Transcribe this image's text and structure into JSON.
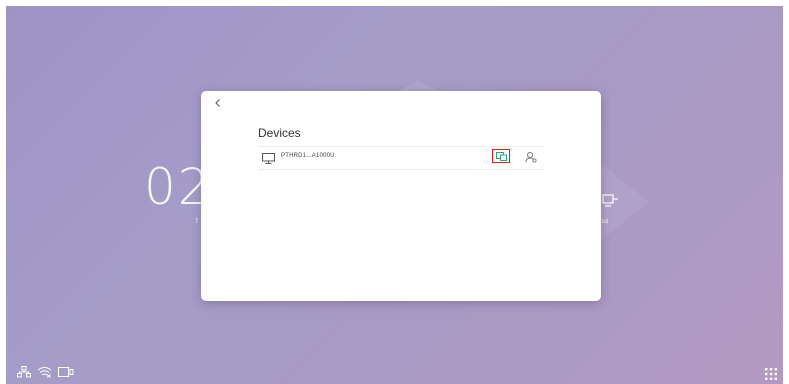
{
  "background": {
    "clock_partial": "02",
    "sub_label": "T",
    "out_label": "out"
  },
  "dialog": {
    "title": "Devices",
    "devices": [
      {
        "name": "PTHRD1...A1000U",
        "icon": "monitor-icon"
      }
    ],
    "actions": {
      "cast_icon": "screen-share-icon",
      "user_icon": "user-settings-icon"
    }
  },
  "statusbar": {
    "icons": [
      "network-icon",
      "wifi-off-icon",
      "screen-mirror-icon"
    ]
  },
  "apps_icon": "apps-grid-icon",
  "colors": {
    "accent": "#2aa37c",
    "highlight": "#e0241b",
    "background_start": "#9f93c6",
    "background_end": "#b39ac2"
  }
}
